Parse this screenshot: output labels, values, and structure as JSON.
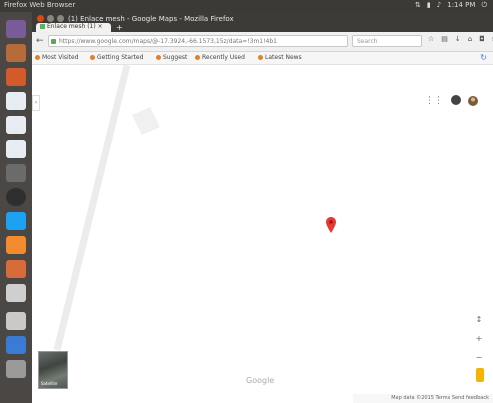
{
  "system": {
    "app_name": "Firefox Web Browser",
    "time": "1:14 PM"
  },
  "window": {
    "title": "(1) Enlace mesh - Google Maps - Mozilla Firefox",
    "tab_label": "Enlace mesh (1) ×",
    "newtab": "+"
  },
  "navbar": {
    "url": "https://www.google.com/maps/@-17.3924,-66.1573,15z/data=!3m1!4b1",
    "search_placeholder": "Search",
    "back": "←"
  },
  "bookmarks": {
    "items": [
      "Most Visited",
      "Getting Started",
      "Suggest",
      "Recently Used",
      "Latest News"
    ],
    "reload": "↻"
  },
  "map": {
    "apps_icon": "⋮⋮",
    "expand": "›",
    "logo": "Google",
    "satellite_label": "Satellite",
    "zoom_in": "+",
    "zoom_out": "−",
    "compass": "↕",
    "footer": "Map data ©2015   Terms   Send feedback",
    "pin_color": "#e53935",
    "road_color": "#ececec"
  }
}
